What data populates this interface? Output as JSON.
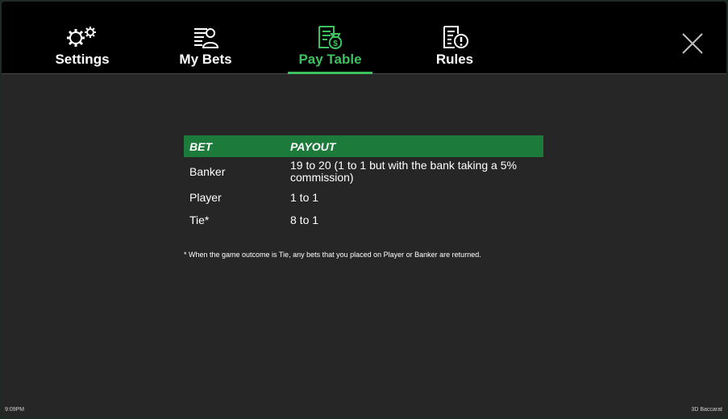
{
  "nav": {
    "tabs": [
      {
        "label": "Settings",
        "icon": "gears-icon",
        "active": false
      },
      {
        "label": "My Bets",
        "icon": "bet-slip-user-icon",
        "active": false
      },
      {
        "label": "Pay Table",
        "icon": "paytable-money-bag-icon",
        "active": true
      },
      {
        "label": "Rules",
        "icon": "rules-document-alert-icon",
        "active": false
      }
    ],
    "close_icon": "close-icon",
    "active_color": "#3cc35f"
  },
  "paytable": {
    "headers": [
      "BET",
      "PAYOUT"
    ],
    "rows": [
      {
        "bet": "Banker",
        "payout": "19 to 20 (1 to 1 but with the bank taking a 5% commission)"
      },
      {
        "bet": "Player",
        "payout": "1 to 1"
      },
      {
        "bet": "Tie*",
        "payout": "8 to 1"
      }
    ],
    "footnote": "* When the game outcome is Tie, any bets that you placed on Player or Banker are returned.",
    "header_color": "#1c7a3a"
  },
  "status": {
    "time": "9:09PM",
    "game_name": "3D Baccarat"
  }
}
